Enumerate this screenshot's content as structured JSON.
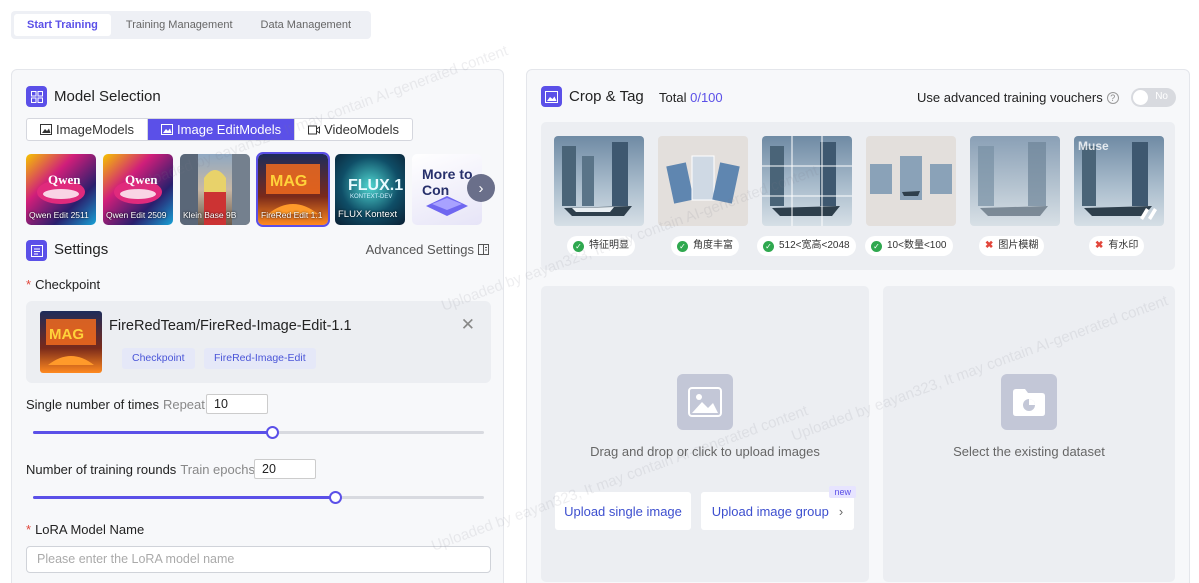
{
  "top_tabs": [
    "Start Training",
    "Training Management",
    "Data Management"
  ],
  "model_selection": {
    "title": "Model Selection",
    "type_tabs": [
      "ImageModels",
      "Image EditModels",
      "VideoModels"
    ],
    "cards": [
      "Qwen Edit 2511",
      "Qwen Edit 2509",
      "Klein Base 9B",
      "FireRed Edit 1.1",
      "FLUX Kontext"
    ],
    "card_images": {
      "flux": "FLUX.1",
      "flux_sub": "KONTEXT-DEV",
      "more": "More to Con"
    }
  },
  "settings": {
    "title": "Settings",
    "advanced": "Advanced Settings",
    "checkpoint_label": "Checkpoint",
    "checkpoint_name": "FireRedTeam/FireRed-Image-Edit-1.1",
    "checkpoint_tags": [
      "Checkpoint",
      "FireRed-Image-Edit"
    ],
    "repeat_label": "Single number of times",
    "repeat_sub": "Repeat",
    "repeat_value": "10",
    "repeat_fraction": 0.53,
    "epochs_label": "Number of training rounds",
    "epochs_sub": "Train epochs",
    "epochs_value": "20",
    "epochs_fraction": 0.67,
    "lora_label": "LoRA Model Name",
    "lora_placeholder": "Please enter the LoRA model name"
  },
  "crop_tag": {
    "title": "Crop & Tag",
    "total_label": "Total",
    "total_count": "0",
    "total_max": "/100",
    "vouchers_label": "Use advanced training vouchers",
    "toggle_text": "No",
    "example_tags": [
      {
        "text": "特征明显",
        "ok": true
      },
      {
        "text": "角度丰富",
        "ok": true
      },
      {
        "text": "512<宽高<2048",
        "ok": true
      },
      {
        "text": "10<数量<100",
        "ok": true
      },
      {
        "text": "图片模糊",
        "ok": false
      },
      {
        "text": "有水印",
        "ok": false
      }
    ],
    "upload_text": "Drag and drop or click to upload images",
    "upload_single": "Upload single image",
    "upload_group": "Upload image group",
    "new_badge": "new",
    "dataset_text": "Select the existing dataset"
  },
  "watermark": "Uploaded by eayan323, It may contain AI-generated content",
  "colors": {
    "accent": "#5b50e8",
    "ok": "#2fa84f",
    "bad": "#e2463b"
  }
}
